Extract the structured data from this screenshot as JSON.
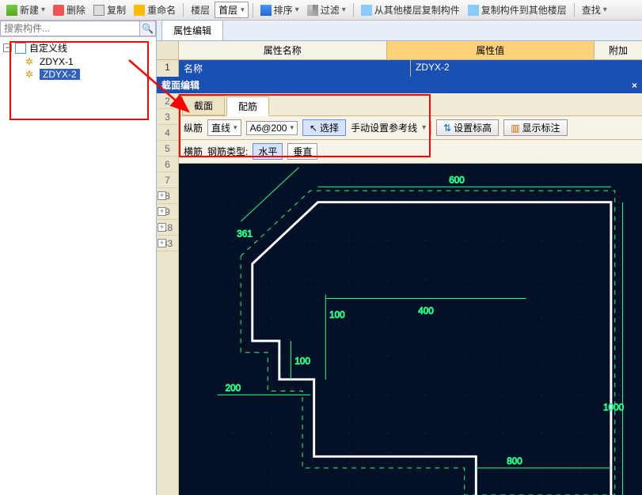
{
  "toolbar": {
    "new": "新建",
    "delete": "删除",
    "copy": "复制",
    "rename": "重命名",
    "floor": "楼层",
    "floor_sel": "首层",
    "sort": "排序",
    "filter": "过滤",
    "copy_from": "从其他楼层复制构件",
    "copy_to": "复制构件到其他楼层",
    "find": "查找"
  },
  "search": {
    "placeholder": "搜索构件..."
  },
  "tree": {
    "root": "自定义线",
    "items": [
      "ZDYX-1",
      "ZDYX-2"
    ],
    "selected_index": 1
  },
  "tabs": {
    "prop": "属性编辑"
  },
  "prop": {
    "col_name": "属性名称",
    "col_value": "属性值",
    "col_attach": "附加",
    "row1_name": "名称",
    "row1_value": "ZDYX-2"
  },
  "section": {
    "title": "截面编辑"
  },
  "row_numbers": [
    "2",
    "3",
    "4",
    "5",
    "6",
    "7",
    "8",
    "9",
    "18",
    "33"
  ],
  "row_expand_idx": [
    7,
    8,
    9
  ],
  "inner_tabs": {
    "section": "截面",
    "rebar": "配筋",
    "active": 1
  },
  "form": {
    "long_label": "纵筋",
    "mode": "直线",
    "spec": "A6@200",
    "pick": "选择",
    "manual": "手动设置参考线",
    "elev": "设置标高",
    "annot": "显示标注",
    "trans_label": "横筋",
    "rebar_type": "钢筋类型:",
    "horiz": "水平",
    "vert": "垂直"
  },
  "cad": {
    "dims": {
      "top": "600",
      "diag": "361",
      "mid_h": "100",
      "mid_w": "400",
      "low_h": "100",
      "low_w": "200",
      "right": "1000",
      "bottom": "800"
    }
  }
}
